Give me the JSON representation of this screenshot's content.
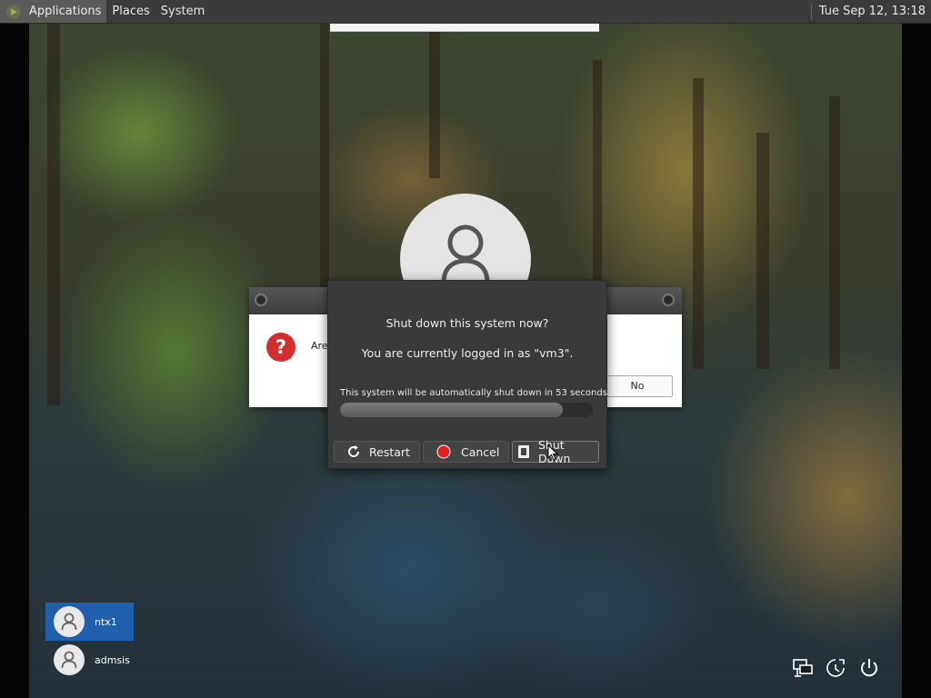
{
  "top_panel": {
    "applications": "Applications",
    "places": "Places",
    "system": "System",
    "clock": "Tue Sep 12, 13:18"
  },
  "background_dialog": {
    "text": "Are",
    "no_button": "No"
  },
  "shutdown_dialog": {
    "title": "Shut down this system now?",
    "logged_in": "You are currently logged in as \"vm3\".",
    "countdown": "This system will be automatically shut down in 53 seconds",
    "progress_fraction": 0.88,
    "restart_label": "Restart",
    "cancel_label": "Cancel",
    "shutdown_label": "Shut Down"
  },
  "users": [
    {
      "name": "ntx1",
      "selected": true
    },
    {
      "name": "admsis",
      "selected": false
    }
  ],
  "colors": {
    "panel": "#3b3b3b",
    "dialog": "#3a3a3a",
    "selected_user": "#1f5fae",
    "question_icon": "#d32f2f"
  },
  "icons": [
    "applications-logo-icon",
    "restart-icon",
    "cancel-icon",
    "shutdown-icon",
    "network-icon",
    "accessibility-icon",
    "power-icon"
  ]
}
